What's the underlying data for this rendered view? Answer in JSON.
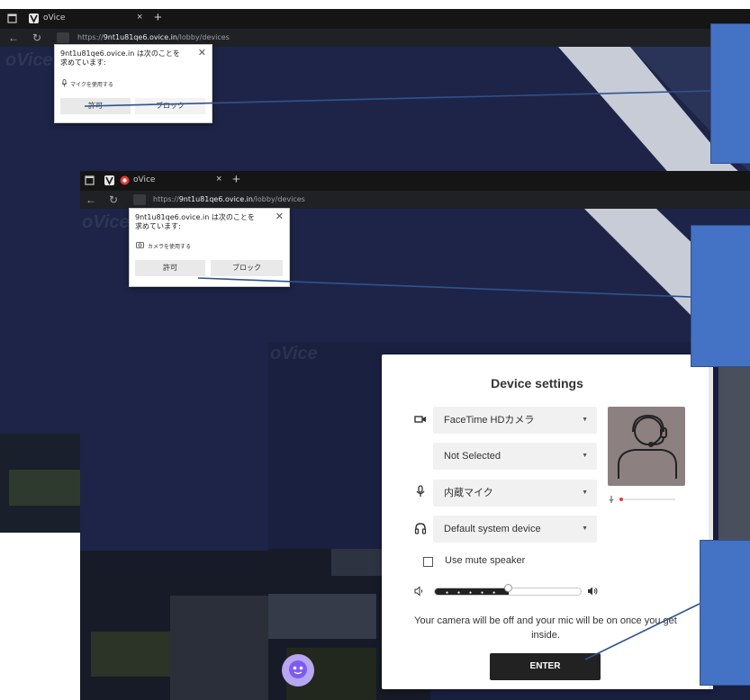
{
  "screenshots": [
    {
      "tab_title": "oVice",
      "url_prefix": "https://",
      "url_host": "9nt1u81qe6.ovice.in",
      "url_path": "/lobby/devices",
      "logo_text": "oVice",
      "popup": {
        "message": "9nt1u81qe6.ovice.in は次のことを求めています:",
        "permission": "マイクを使用する",
        "allow_label": "許可",
        "block_label": "ブロック"
      }
    },
    {
      "tab_title": "oVice",
      "url_prefix": "https://",
      "url_host": "9nt1u81qe6.ovice.in",
      "url_path": "/lobby/devices",
      "logo_text": "oVice",
      "popup": {
        "message": "9nt1u81qe6.ovice.in は次のことを求めています:",
        "permission": "カメラを使用する",
        "allow_label": "許可",
        "block_label": "ブロック"
      }
    }
  ],
  "device_settings": {
    "logo_text": "oVice",
    "title": "Device settings",
    "camera_select": "FaceTime HDカメラ",
    "secondary_select": "Not Selected",
    "mic_select": "内蔵マイク",
    "speaker_select": "Default system device",
    "mute_speaker_label": "Use mute speaker",
    "mute_speaker_checked": false,
    "speaker_volume": 0.5,
    "mic_level": 0.05,
    "info_text": "Your camera will be off and your mic will be on once you get inside.",
    "enter_label": "ENTER"
  },
  "icons": {
    "camera": "video-camera-icon",
    "mic": "microphone-icon",
    "headphones": "headphones-icon",
    "volume_low": "volume-low-icon",
    "volume_high": "volume-high-icon",
    "avatar": "person-headset-icon",
    "chat": "chat-bot-icon"
  },
  "colors": {
    "callout_fill": "#4472c4",
    "callout_line": "#2f528f",
    "night_sky": "#1c2340",
    "enter_button": "#222222",
    "mic_dot": "#e53935",
    "chat_bubble": "#b8a6f2"
  }
}
